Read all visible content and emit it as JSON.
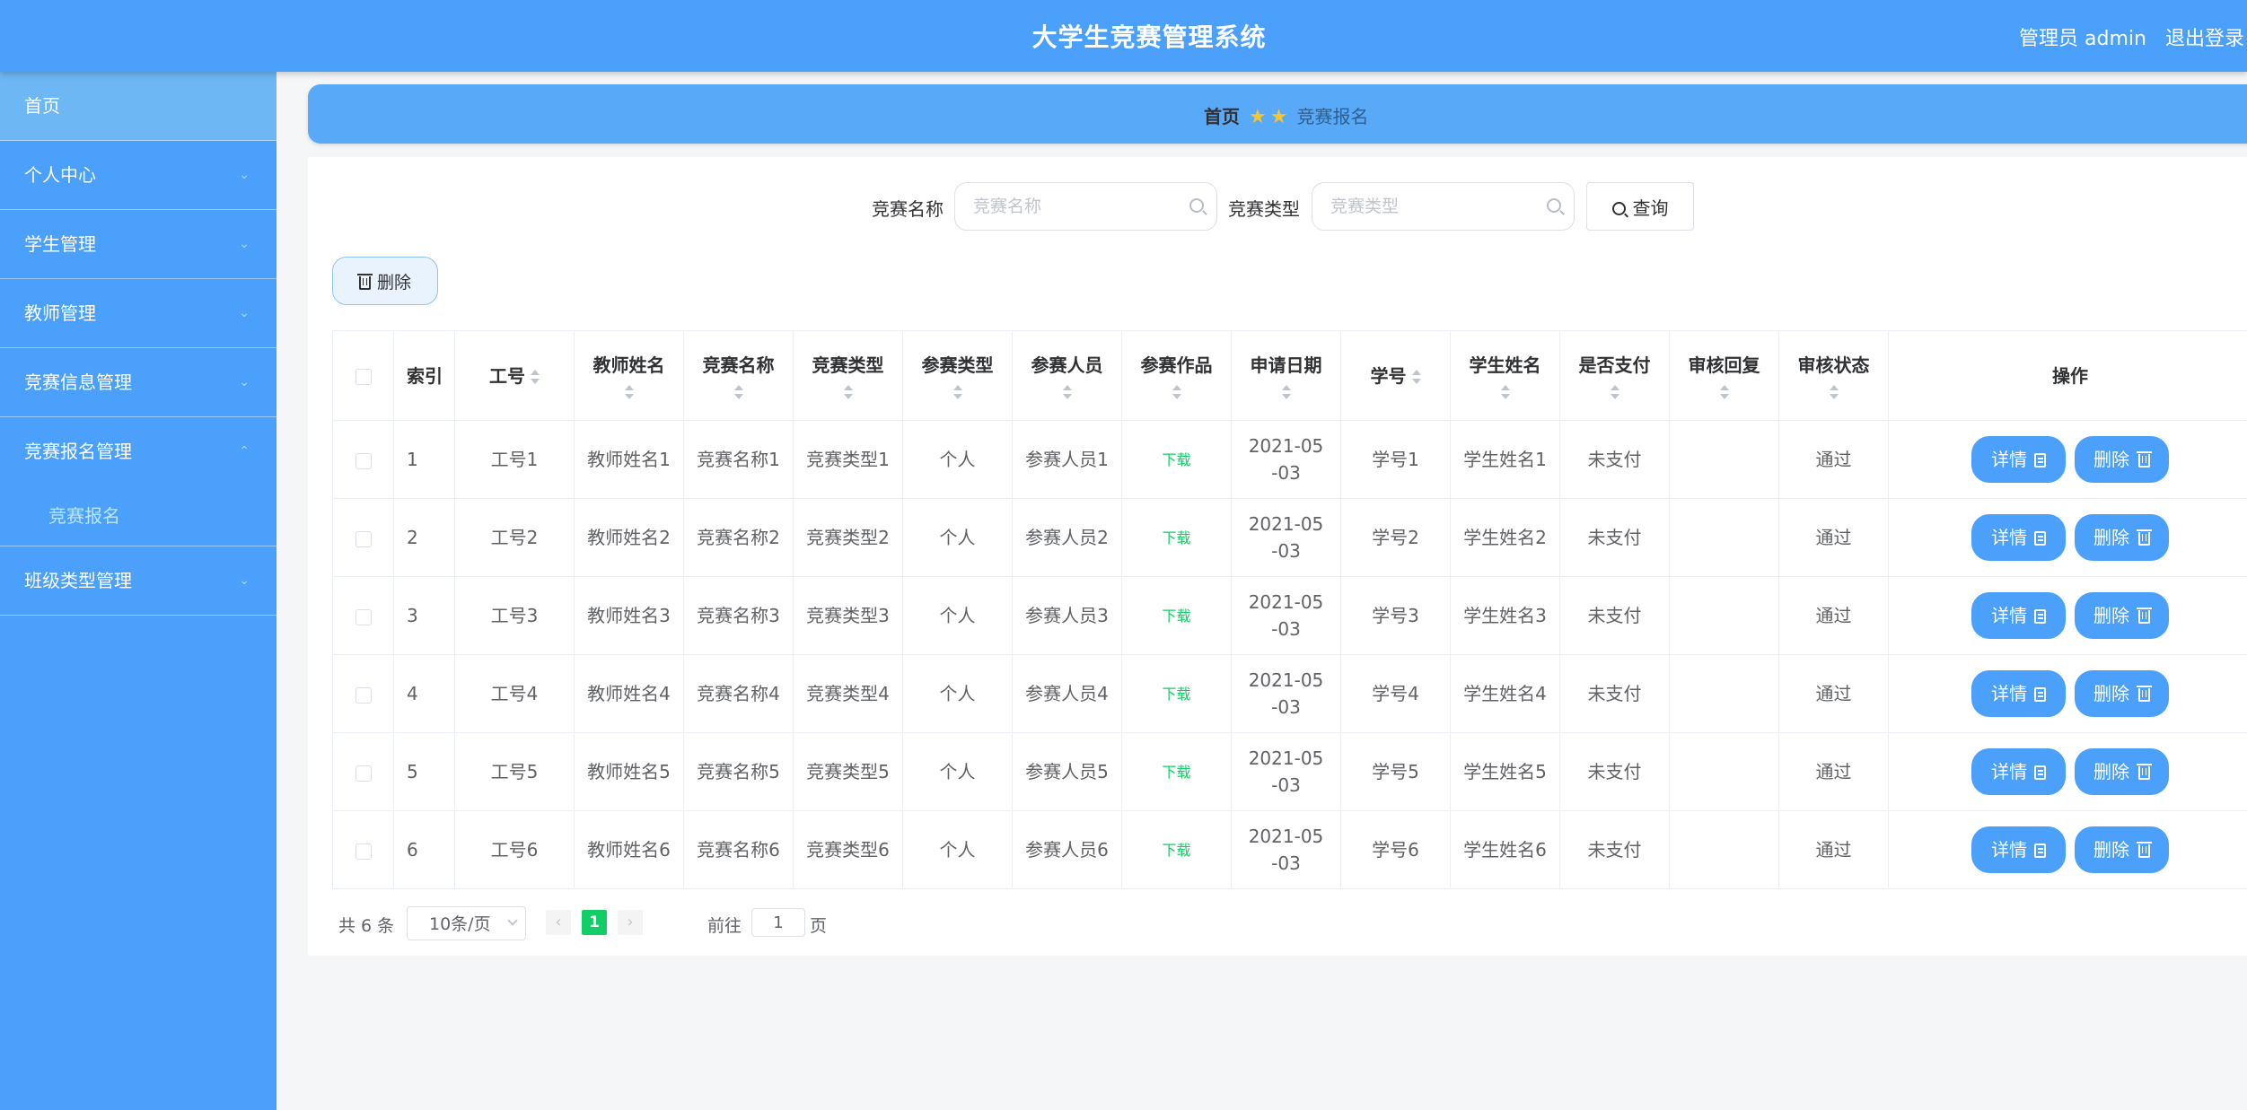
{
  "app": {
    "title": "大学生竞赛管理系统",
    "user": "管理员 admin",
    "logout": "退出登录"
  },
  "sidebar": {
    "items": [
      {
        "label": "首页"
      },
      {
        "label": "个人中心"
      },
      {
        "label": "学生管理"
      },
      {
        "label": "教师管理"
      },
      {
        "label": "竞赛信息管理"
      },
      {
        "label": "竞赛报名管理",
        "children": [
          {
            "label": "竞赛报名"
          }
        ]
      },
      {
        "label": "班级类型管理"
      }
    ]
  },
  "breadcrumb": {
    "home": "首页",
    "current": "竞赛报名"
  },
  "search": {
    "name_label": "竞赛名称",
    "name_placeholder": "竞赛名称",
    "type_label": "竞赛类型",
    "type_placeholder": "竞赛类型",
    "query_label": "查询"
  },
  "toolbar": {
    "delete_label": "删除"
  },
  "table": {
    "columns": [
      "索引",
      "工号",
      "教师姓名",
      "竞赛名称",
      "竞赛类型",
      "参赛类型",
      "参赛人员",
      "参赛作品",
      "申请日期",
      "学号",
      "学生姓名",
      "是否支付",
      "审核回复",
      "审核状态",
      "操作"
    ],
    "rows": [
      {
        "index": "1",
        "gonghao": "工号1",
        "teacher": "教师姓名1",
        "comp_name": "竞赛名称1",
        "comp_type": "竞赛类型1",
        "join_type": "个人",
        "members": "参赛人员1",
        "works": "下载",
        "date": "2021-05-03",
        "student_no": "学号1",
        "student": "学生姓名1",
        "paid": "未支付",
        "reply": "",
        "status": "通过"
      },
      {
        "index": "2",
        "gonghao": "工号2",
        "teacher": "教师姓名2",
        "comp_name": "竞赛名称2",
        "comp_type": "竞赛类型2",
        "join_type": "个人",
        "members": "参赛人员2",
        "works": "下载",
        "date": "2021-05-03",
        "student_no": "学号2",
        "student": "学生姓名2",
        "paid": "未支付",
        "reply": "",
        "status": "通过"
      },
      {
        "index": "3",
        "gonghao": "工号3",
        "teacher": "教师姓名3",
        "comp_name": "竞赛名称3",
        "comp_type": "竞赛类型3",
        "join_type": "个人",
        "members": "参赛人员3",
        "works": "下载",
        "date": "2021-05-03",
        "student_no": "学号3",
        "student": "学生姓名3",
        "paid": "未支付",
        "reply": "",
        "status": "通过"
      },
      {
        "index": "4",
        "gonghao": "工号4",
        "teacher": "教师姓名4",
        "comp_name": "竞赛名称4",
        "comp_type": "竞赛类型4",
        "join_type": "个人",
        "members": "参赛人员4",
        "works": "下载",
        "date": "2021-05-03",
        "student_no": "学号4",
        "student": "学生姓名4",
        "paid": "未支付",
        "reply": "",
        "status": "通过"
      },
      {
        "index": "5",
        "gonghao": "工号5",
        "teacher": "教师姓名5",
        "comp_name": "竞赛名称5",
        "comp_type": "竞赛类型5",
        "join_type": "个人",
        "members": "参赛人员5",
        "works": "下载",
        "date": "2021-05-03",
        "student_no": "学号5",
        "student": "学生姓名5",
        "paid": "未支付",
        "reply": "",
        "status": "通过"
      },
      {
        "index": "6",
        "gonghao": "工号6",
        "teacher": "教师姓名6",
        "comp_name": "竞赛名称6",
        "comp_type": "竞赛类型6",
        "join_type": "个人",
        "members": "参赛人员6",
        "works": "下载",
        "date": "2021-05-03",
        "student_no": "学号6",
        "student": "学生姓名6",
        "paid": "未支付",
        "reply": "",
        "status": "通过"
      }
    ],
    "detail_label": "详情",
    "delete_label": "删除"
  },
  "pagination": {
    "total_text": "共 6 条",
    "page_size": "10条/页",
    "current_page": "1",
    "prev": "‹",
    "next": "›",
    "goto_label": "前往",
    "goto_value": "1",
    "page_suffix": "页"
  },
  "colors": {
    "primary": "#4aa0fb",
    "success": "#13ce66",
    "star": "#f7c531"
  },
  "icons": [
    "search-icon",
    "trash-icon",
    "document-icon",
    "star-icon",
    "chevron-down-icon",
    "chevron-up-icon",
    "chevron-left-icon",
    "chevron-right-icon"
  ]
}
